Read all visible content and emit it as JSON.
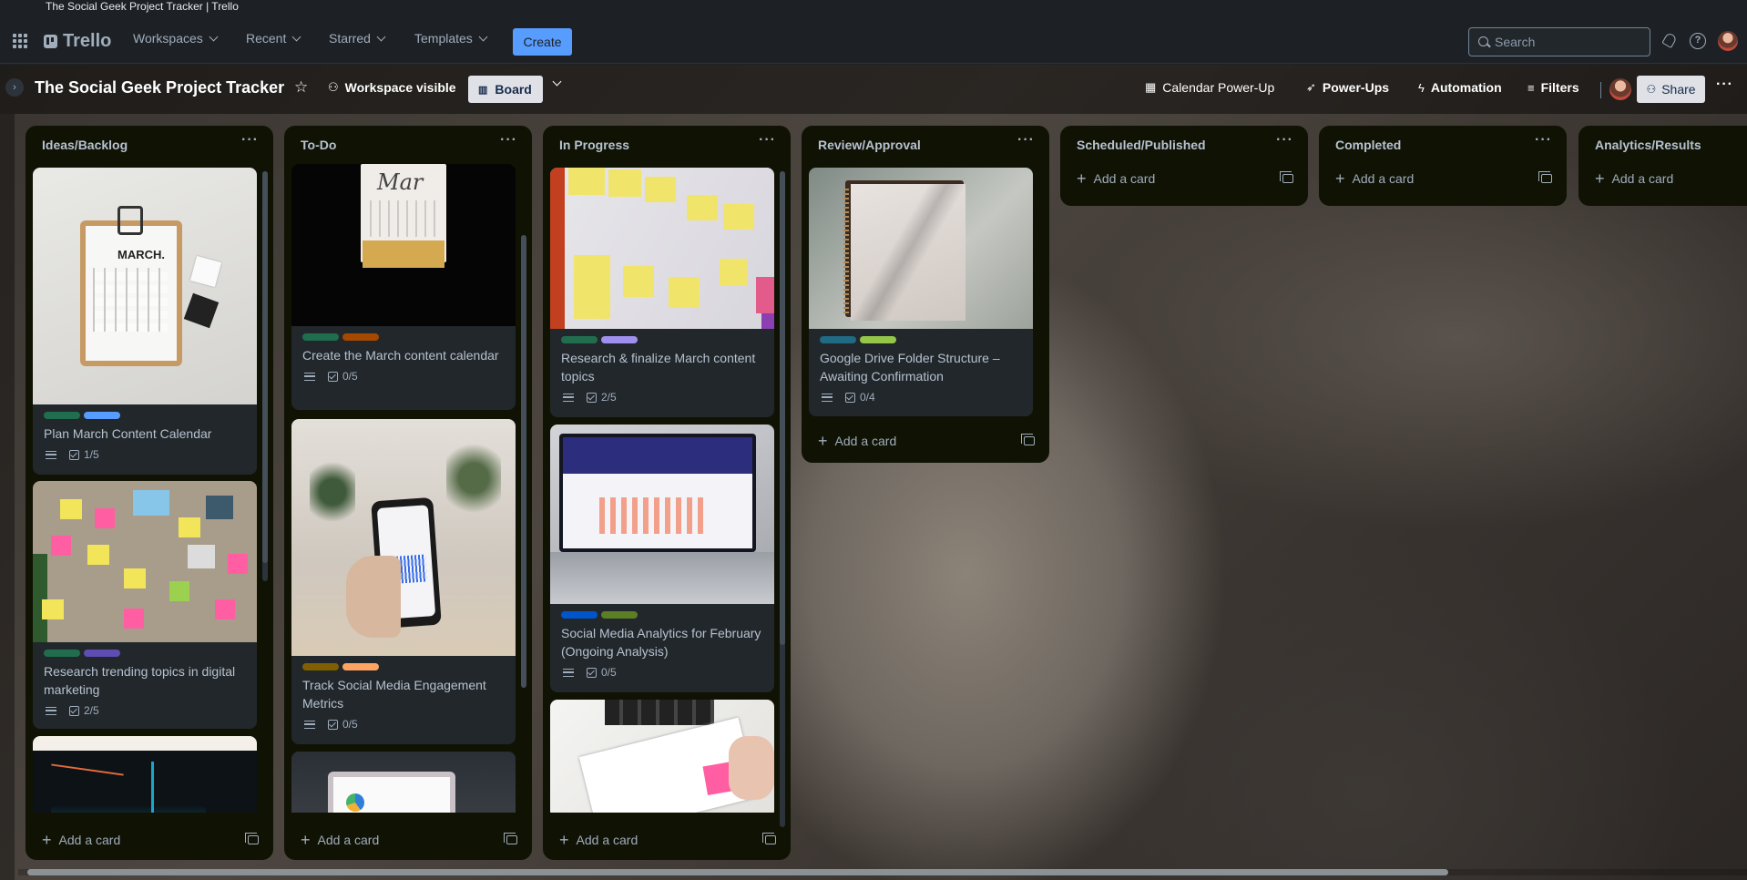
{
  "window_title": "The Social Geek Project Tracker | Trello",
  "nav": {
    "logo": "Trello",
    "menus": [
      "Workspaces",
      "Recent",
      "Starred",
      "Templates"
    ],
    "create_label": "Create",
    "search_placeholder": "Search"
  },
  "board": {
    "title": "The Social Geek Project Tracker",
    "visibility": "Workspace visible",
    "view": "Board",
    "calendar_powerup": "Calendar Power-Up",
    "powerups": "Power-Ups",
    "automation": "Automation",
    "filters": "Filters",
    "share": "Share"
  },
  "lists": [
    {
      "name": "Ideas/Backlog",
      "add_label": "Add a card",
      "cards": [
        {
          "title": "Plan March Content Calendar",
          "labels": [
            "#216e4e",
            "#579dff"
          ],
          "checklist": "1/5",
          "cover": "march-clipboard"
        },
        {
          "title": "Research trending topics in digital marketing",
          "labels": [
            "#216e4e",
            "#5e4db2"
          ],
          "checklist": "2/5",
          "cover": "sticky-wall"
        },
        {
          "title": "",
          "labels": [],
          "checklist": "",
          "cover": "analytics-monitor"
        }
      ]
    },
    {
      "name": "To-Do",
      "add_label": "Add a card",
      "cards": [
        {
          "title": "Create the March content calendar",
          "labels": [
            "#216e4e",
            "#a54800"
          ],
          "checklist": "0/5",
          "cover": "desk-calendar"
        },
        {
          "title": "Track Social Media Engagement Metrics",
          "labels": [
            "#7f5f01",
            "#fea362"
          ],
          "checklist": "0/5",
          "cover": "phone-chart"
        },
        {
          "title": "",
          "labels": [],
          "checklist": "",
          "cover": "laptop-pie"
        }
      ]
    },
    {
      "name": "In Progress",
      "add_label": "Add a card",
      "cards": [
        {
          "title": "Research & finalize March content topics",
          "labels": [
            "#216e4e",
            "#9f8fef"
          ],
          "checklist": "2/5",
          "cover": "sticky-board"
        },
        {
          "title": "Social Media Analytics for February (Ongoing Analysis)",
          "labels": [
            "#0055cc",
            "#5b7f24"
          ],
          "checklist": "0/5",
          "cover": "laptop-dashboard"
        },
        {
          "title": "",
          "labels": [],
          "checklist": "",
          "cover": "desk-planner"
        }
      ]
    },
    {
      "name": "Review/Approval",
      "add_label": "Add a card",
      "cards": [
        {
          "title": "Google Drive Folder Structure – Awaiting Confirmation",
          "labels": [
            "#206a83",
            "#94c748"
          ],
          "checklist": "0/4",
          "cover": "notebook"
        }
      ]
    },
    {
      "name": "Scheduled/Published",
      "add_label": "Add a card",
      "cards": []
    },
    {
      "name": "Completed",
      "add_label": "Add a card",
      "cards": []
    },
    {
      "name": "Analytics/Results",
      "add_label": "Add a card",
      "cards": []
    }
  ],
  "colors": {
    "accent": "#579dff",
    "list_bg": "#101204",
    "card_bg": "#22272b"
  }
}
